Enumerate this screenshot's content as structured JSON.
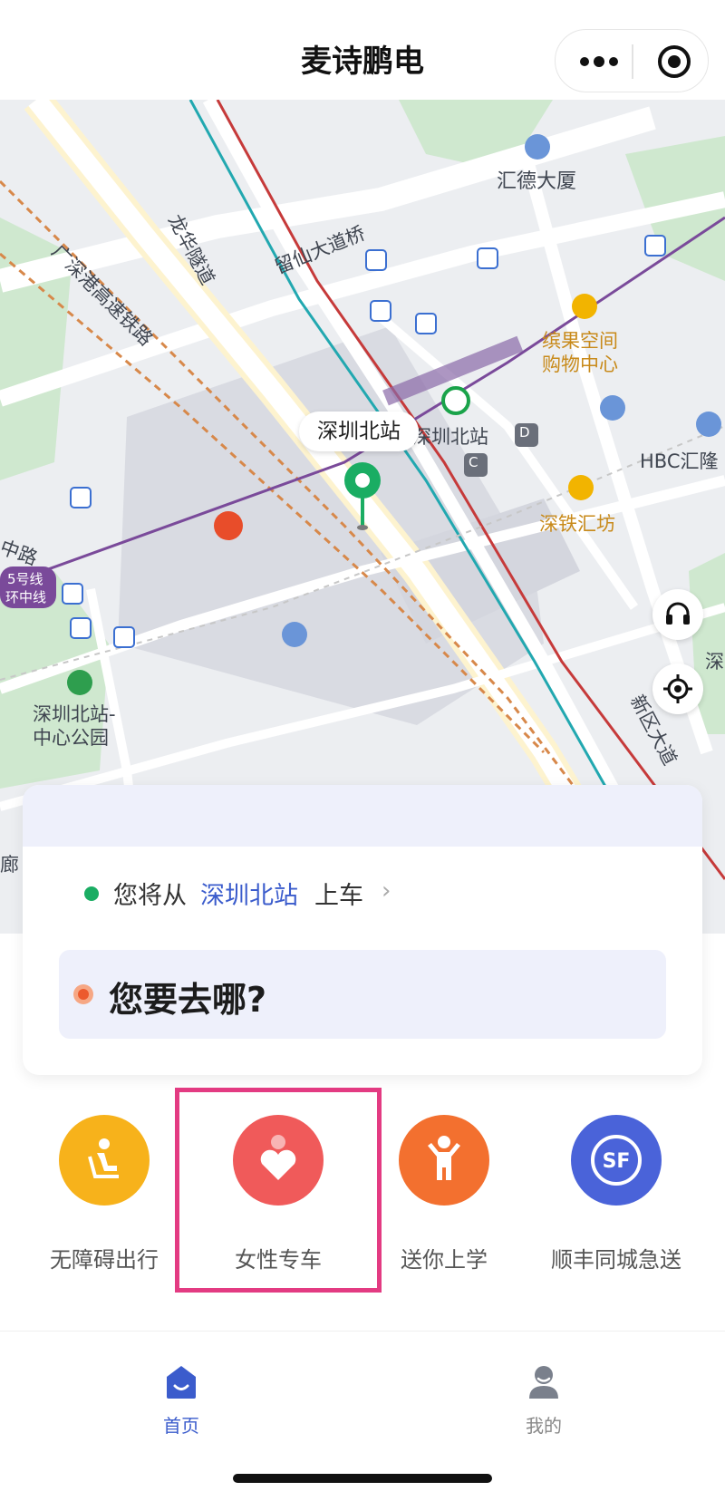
{
  "header": {
    "title": "麦诗鹏电",
    "more_icon": "more-dots-icon",
    "close_icon": "target-circle-icon"
  },
  "map": {
    "labels": {
      "huide": "汇德大厦",
      "liuxian_bridge": "留仙大道桥",
      "longhua_tunnel": "龙华隧道",
      "guangshen_rail": "广深港高速铁路",
      "binguo": "缤果空间",
      "gouwu": "购物中心",
      "station_right": "深圳北站",
      "hbc": "HBC汇隆",
      "shentie": "深铁汇坊",
      "zhonglu": "中路",
      "line5a": "5号线",
      "line5b": "环中线",
      "park1": "深圳北站-",
      "park2": "中心公园",
      "xinqu": "新区大道",
      "shen_edge": "深",
      "lang": "廊",
      "c_badge": "C",
      "d_badge": "D"
    },
    "pin_label": "深圳北站",
    "support_icon": "headset-icon",
    "locate_icon": "locate-icon"
  },
  "trip": {
    "from_prefix": "您将从",
    "from_station": "深圳北站",
    "from_suffix": "上车",
    "chevron": "›",
    "destination_placeholder": "您要去哪?"
  },
  "services": [
    {
      "label": "无障碍出行",
      "icon": "accessible-seat-icon",
      "color": "#f7b21b"
    },
    {
      "label": "女性专车",
      "icon": "female-heart-icon",
      "color": "#f05a5a"
    },
    {
      "label": "送你上学",
      "icon": "child-icon",
      "color": "#f3702f"
    },
    {
      "label": "顺丰同城急送",
      "icon": "sf-express-icon",
      "color": "#4a63d9"
    }
  ],
  "tabbar": {
    "home_label": "首页",
    "me_label": "我的",
    "active_color": "#3b5ccc",
    "inactive_color": "#888888"
  }
}
